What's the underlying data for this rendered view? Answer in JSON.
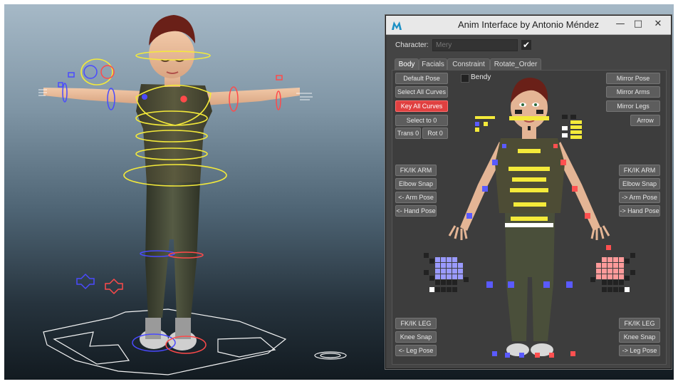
{
  "window": {
    "title": "Anim Interface by Antonio Méndez",
    "controls": {
      "minimize": "—",
      "maximize": "□",
      "close": "✕"
    }
  },
  "character": {
    "label": "Character:",
    "value": "Mery",
    "checkmark": "✔"
  },
  "tabs": [
    "Body",
    "Facials",
    "Constraint",
    "Rotate_Order"
  ],
  "active_tab": "Body",
  "buttons": {
    "default_pose": "Default Pose",
    "select_all_curves": "Select All Curves",
    "key_all_curves": "Key All Curves",
    "select_to_0": "Select to 0",
    "trans_0": "Trans 0",
    "rot_0": "Rot 0",
    "bendy": "Bendy",
    "mirror_pose": "Mirror Pose",
    "mirror_arms": "Mirror Arms",
    "mirror_legs": "Mirror Legs",
    "arrow": "Arrow",
    "fkik_arm_left": "FK/IK ARM",
    "elbow_snap_left": "Elbow Snap",
    "arm_pose_left": "<- Arm Pose",
    "hand_pose_left": "<- Hand Pose",
    "fkik_arm_right": "FK/IK ARM",
    "elbow_snap_right": "Elbow Snap",
    "arm_pose_right": "-> Arm Pose",
    "hand_pose_right": "-> Hand Pose",
    "fkik_leg_left": "FK/IK LEG",
    "knee_snap_left": "Knee Snap",
    "leg_pose_left": "<- Leg Pose",
    "fkik_leg_right": "FK/IK LEG",
    "knee_snap_right": "Knee Snap",
    "leg_pose_right": "-> Leg Pose"
  },
  "colors": {
    "left_side": "#5a5aff",
    "right_side": "#ff4a4a",
    "center": "#f4ea3a",
    "key_button": "#e04040",
    "panel_bg": "#444444"
  }
}
